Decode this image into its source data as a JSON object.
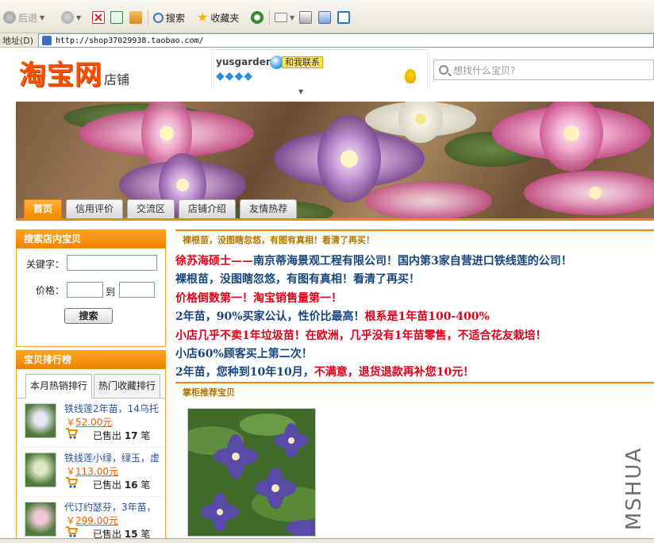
{
  "browser": {
    "toolbar": {
      "back_label": "后退",
      "search_label": "搜索",
      "favorites_label": "收藏夹"
    },
    "address": {
      "label": "地址(D)",
      "url": "http://shop37029938.taobao.com/"
    }
  },
  "header": {
    "logo_text": "淘宝网",
    "logo_suffix": "店铺",
    "shop_name": "yusgarden",
    "contact_label": "和我联系",
    "diamond_count": 4,
    "search_placeholder": "想找什么宝贝?"
  },
  "nav": {
    "tabs": [
      {
        "label": "首页",
        "active": true
      },
      {
        "label": "信用评价",
        "active": false
      },
      {
        "label": "交流区",
        "active": false
      },
      {
        "label": "店铺介绍",
        "active": false
      },
      {
        "label": "友情热荐",
        "active": false
      }
    ]
  },
  "sidebar": {
    "search_title": "搜索店内宝贝",
    "keyword_label": "关键字：",
    "price_label": "价格：",
    "price_to": "到",
    "search_button": "搜索",
    "rank_title": "宝贝排行榜",
    "rank_tabs": [
      {
        "label": "本月热销排行",
        "active": true
      },
      {
        "label": "热门收藏排行",
        "active": false
      }
    ],
    "items": [
      {
        "name": "铁线莲2年苗，14乌托",
        "currency": "￥",
        "price": "52.00元",
        "sold_prefix": "已售出",
        "sold_count": "17",
        "sold_unit": "笔"
      },
      {
        "name": "铁线莲小绿，绿玉，虚",
        "currency": "￥",
        "price": "113.00元",
        "sold_prefix": "已售出",
        "sold_count": "16",
        "sold_unit": "笔"
      },
      {
        "name": "代订约瑟芬，3年苗，",
        "currency": "￥",
        "price": "299.00元",
        "sold_prefix": "已售出",
        "sold_count": "15",
        "sold_unit": "笔"
      }
    ]
  },
  "main": {
    "announce_heading": "裸根苗，没图瞎忽悠，有图有真相！看清了再买！",
    "lines": [
      [
        {
          "text": "徐苏海硕士——",
          "color": "red"
        },
        {
          "text": "南京蒂海景观工程有限公司！国内第3家自营进口铁线莲的公司！",
          "color": "blue"
        }
      ],
      [
        {
          "text": "裸根苗，没图瞎忽悠，有图有真相！看清了再买！",
          "color": "blue"
        }
      ],
      [
        {
          "text": "价格倒数第一！淘宝销售量第一！",
          "color": "red"
        }
      ],
      [
        {
          "text": "2年苗，90%买家公认，性价比最高！",
          "color": "blue"
        },
        {
          "text": "根系是1年苗100-400%",
          "color": "red"
        }
      ],
      [
        {
          "text": "小店几乎不卖1年垃圾苗！在欧洲，几乎没有1年苗零售，不适合花友栽培！",
          "color": "red"
        }
      ],
      [
        {
          "text": "小店60%顾客买上第二次！",
          "color": "blue"
        }
      ],
      [
        {
          "text": "2年苗，您种到10年10月，",
          "color": "blue"
        },
        {
          "text": "不满意，退货退款再补您10元！",
          "color": "red"
        }
      ]
    ],
    "recommend_heading": "掌柜推荐宝贝"
  },
  "watermark": "MSHUA",
  "colors": {
    "accent_orange": "#f08a00",
    "taobao_orange": "#ff5000",
    "link_blue": "#2953a6",
    "price_orange": "#f25c00",
    "text_red": "#e0001a",
    "text_blue": "#17467e"
  }
}
